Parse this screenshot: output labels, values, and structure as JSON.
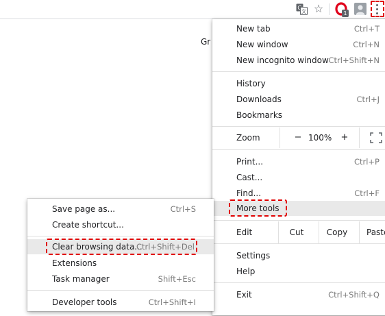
{
  "toolbar": {
    "icons": [
      "translate-icon",
      "star-icon",
      "opera-extension-icon",
      "avatar-icon",
      "kebab-menu-icon"
    ],
    "extension_badge": "1"
  },
  "page": {
    "fragment_text": "Gr"
  },
  "main_menu": {
    "new_tab": {
      "label": "New tab",
      "shortcut": "Ctrl+T"
    },
    "new_window": {
      "label": "New window",
      "shortcut": "Ctrl+N"
    },
    "new_incognito": {
      "label": "New incognito window",
      "shortcut": "Ctrl+Shift+N"
    },
    "history": {
      "label": "History"
    },
    "downloads": {
      "label": "Downloads",
      "shortcut": "Ctrl+J"
    },
    "bookmarks": {
      "label": "Bookmarks"
    },
    "zoom": {
      "label": "Zoom",
      "minus": "−",
      "value": "100%",
      "plus": "+"
    },
    "print": {
      "label": "Print...",
      "shortcut": "Ctrl+P"
    },
    "cast": {
      "label": "Cast..."
    },
    "find": {
      "label": "Find...",
      "shortcut": "Ctrl+F"
    },
    "more_tools": {
      "label": "More tools"
    },
    "edit": {
      "label": "Edit",
      "cut": "Cut",
      "copy": "Copy",
      "paste": "Paste"
    },
    "settings": {
      "label": "Settings"
    },
    "help": {
      "label": "Help"
    },
    "exit": {
      "label": "Exit",
      "shortcut": "Ctrl+Shift+Q"
    }
  },
  "sub_menu": {
    "save_page": {
      "label": "Save page as...",
      "shortcut": "Ctrl+S"
    },
    "create_shortcut": {
      "label": "Create shortcut..."
    },
    "clear_browsing": {
      "label": "Clear browsing data...",
      "shortcut": "Ctrl+Shift+Del"
    },
    "extensions": {
      "label": "Extensions"
    },
    "task_manager": {
      "label": "Task manager",
      "shortcut": "Shift+Esc"
    },
    "developer_tools": {
      "label": "Developer tools",
      "shortcut": "Ctrl+Shift+I"
    }
  },
  "colors": {
    "highlight_box": "#e00000",
    "hover_bg": "#e9e9e9",
    "text": "#202124",
    "shortcut_text": "#7a7a7a"
  }
}
